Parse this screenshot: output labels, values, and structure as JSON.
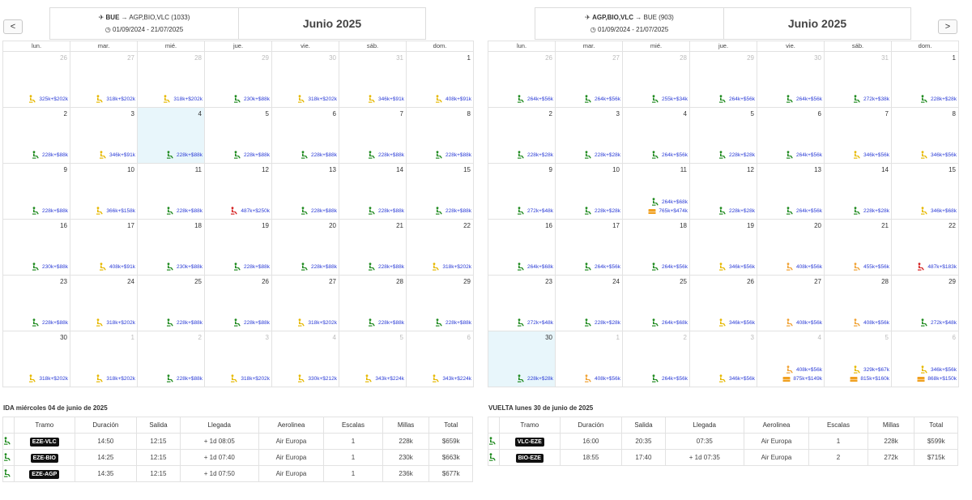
{
  "nav": {
    "prev": "<",
    "next": ">"
  },
  "left": {
    "route": "BUE → AGP,BIO,VLC (1033)",
    "origin": "BUE",
    "dest": "AGP,BIO,VLC (1033)",
    "dates": "01/09/2024 - 21/07/2025",
    "month": "Junio 2025",
    "dows": [
      "lun.",
      "mar.",
      "mié.",
      "jue.",
      "vie.",
      "sáb.",
      "dom."
    ],
    "weeks": [
      [
        {
          "d": "26",
          "dim": true,
          "p": "325k+$202k",
          "c": "y"
        },
        {
          "d": "27",
          "dim": true,
          "p": "318k+$202k",
          "c": "y"
        },
        {
          "d": "28",
          "dim": true,
          "p": "318k+$202k",
          "c": "y"
        },
        {
          "d": "29",
          "dim": true,
          "p": "230k+$88k",
          "c": "g"
        },
        {
          "d": "30",
          "dim": true,
          "p": "318k+$202k",
          "c": "y"
        },
        {
          "d": "31",
          "dim": true,
          "p": "346k+$91k",
          "c": "y"
        },
        {
          "d": "1",
          "p": "408k+$91k",
          "c": "y"
        }
      ],
      [
        {
          "d": "2",
          "p": "228k+$88k",
          "c": "g"
        },
        {
          "d": "3",
          "p": "346k+$91k",
          "c": "y"
        },
        {
          "d": "4",
          "sel": true,
          "p": "228k+$88k",
          "c": "g"
        },
        {
          "d": "5",
          "p": "228k+$88k",
          "c": "g"
        },
        {
          "d": "6",
          "p": "228k+$88k",
          "c": "g"
        },
        {
          "d": "7",
          "p": "228k+$88k",
          "c": "g"
        },
        {
          "d": "8",
          "p": "228k+$88k",
          "c": "g"
        }
      ],
      [
        {
          "d": "9",
          "p": "228k+$88k",
          "c": "g"
        },
        {
          "d": "10",
          "p": "366k+$158k",
          "c": "y"
        },
        {
          "d": "11",
          "p": "228k+$88k",
          "c": "g"
        },
        {
          "d": "12",
          "p": "487k+$250k",
          "c": "r"
        },
        {
          "d": "13",
          "p": "228k+$88k",
          "c": "g"
        },
        {
          "d": "14",
          "p": "228k+$88k",
          "c": "g"
        },
        {
          "d": "15",
          "p": "228k+$88k",
          "c": "g"
        }
      ],
      [
        {
          "d": "16",
          "p": "230k+$88k",
          "c": "g"
        },
        {
          "d": "17",
          "p": "408k+$91k",
          "c": "y"
        },
        {
          "d": "18",
          "p": "230k+$88k",
          "c": "g"
        },
        {
          "d": "19",
          "p": "228k+$88k",
          "c": "g"
        },
        {
          "d": "20",
          "p": "228k+$88k",
          "c": "g"
        },
        {
          "d": "21",
          "p": "228k+$88k",
          "c": "g"
        },
        {
          "d": "22",
          "p": "318k+$202k",
          "c": "y"
        }
      ],
      [
        {
          "d": "23",
          "p": "228k+$88k",
          "c": "g"
        },
        {
          "d": "24",
          "p": "318k+$202k",
          "c": "y"
        },
        {
          "d": "25",
          "p": "228k+$88k",
          "c": "g"
        },
        {
          "d": "26",
          "p": "228k+$88k",
          "c": "g"
        },
        {
          "d": "27",
          "p": "318k+$202k",
          "c": "y"
        },
        {
          "d": "28",
          "p": "228k+$88k",
          "c": "g"
        },
        {
          "d": "29",
          "p": "228k+$88k",
          "c": "g"
        }
      ],
      [
        {
          "d": "30",
          "p": "318k+$202k",
          "c": "y"
        },
        {
          "d": "1",
          "dim": true,
          "p": "318k+$202k",
          "c": "y"
        },
        {
          "d": "2",
          "dim": true,
          "p": "228k+$88k",
          "c": "g"
        },
        {
          "d": "3",
          "dim": true,
          "p": "318k+$202k",
          "c": "y"
        },
        {
          "d": "4",
          "dim": true,
          "p": "330k+$212k",
          "c": "y"
        },
        {
          "d": "5",
          "dim": true,
          "p": "343k+$224k",
          "c": "y"
        },
        {
          "d": "6",
          "dim": true,
          "p": "343k+$224k",
          "c": "y"
        }
      ]
    ],
    "section": "IDA miércoles 04 de junio de 2025",
    "headers": [
      "Tramo",
      "Duración",
      "Salida",
      "Llegada",
      "Aerolinea",
      "Escalas",
      "Millas",
      "Total"
    ],
    "rows": [
      {
        "tramo": "EZE-VLC",
        "dur": "14:50",
        "sal": "12:15",
        "lle": "+ 1d 08:05",
        "aer": "Air Europa",
        "esc": "1",
        "mil": "228k",
        "tot": "$659k"
      },
      {
        "tramo": "EZE-BIO",
        "dur": "14:25",
        "sal": "12:15",
        "lle": "+ 1d 07:40",
        "aer": "Air Europa",
        "esc": "1",
        "mil": "230k",
        "tot": "$663k"
      },
      {
        "tramo": "EZE-AGP",
        "dur": "14:35",
        "sal": "12:15",
        "lle": "+ 1d 07:50",
        "aer": "Air Europa",
        "esc": "1",
        "mil": "236k",
        "tot": "$677k"
      }
    ]
  },
  "right": {
    "route": "AGP,BIO,VLC → BUE (903)",
    "origin": "AGP,BIO,VLC",
    "dest": "BUE (903)",
    "dates": "01/09/2024 - 21/07/2025",
    "month": "Junio 2025",
    "dows": [
      "lun.",
      "mar.",
      "mié.",
      "jue.",
      "vie.",
      "sáb.",
      "dom."
    ],
    "weeks": [
      [
        {
          "d": "26",
          "dim": true,
          "p": "264k+$56k",
          "c": "g"
        },
        {
          "d": "27",
          "dim": true,
          "p": "264k+$56k",
          "c": "g"
        },
        {
          "d": "28",
          "dim": true,
          "p": "255k+$34k",
          "c": "g"
        },
        {
          "d": "29",
          "dim": true,
          "p": "264k+$56k",
          "c": "g"
        },
        {
          "d": "30",
          "dim": true,
          "p": "264k+$56k",
          "c": "g"
        },
        {
          "d": "31",
          "dim": true,
          "p": "272k+$38k",
          "c": "g"
        },
        {
          "d": "1",
          "p": "228k+$28k",
          "c": "g"
        }
      ],
      [
        {
          "d": "2",
          "p": "228k+$28k",
          "c": "g"
        },
        {
          "d": "3",
          "p": "228k+$28k",
          "c": "g"
        },
        {
          "d": "4",
          "p": "264k+$56k",
          "c": "g"
        },
        {
          "d": "5",
          "p": "228k+$28k",
          "c": "g"
        },
        {
          "d": "6",
          "p": "264k+$56k",
          "c": "g"
        },
        {
          "d": "7",
          "p": "346k+$56k",
          "c": "y"
        },
        {
          "d": "8",
          "p": "346k+$56k",
          "c": "y"
        }
      ],
      [
        {
          "d": "9",
          "p": "272k+$48k",
          "c": "g"
        },
        {
          "d": "10",
          "p": "228k+$28k",
          "c": "g"
        },
        {
          "d": "11",
          "p2": "264k+$68k",
          "c2": "g",
          "p": "765k+$474k",
          "c": "b"
        },
        {
          "d": "12",
          "p": "228k+$28k",
          "c": "g"
        },
        {
          "d": "13",
          "p": "264k+$56k",
          "c": "g"
        },
        {
          "d": "14",
          "p": "228k+$28k",
          "c": "g"
        },
        {
          "d": "15",
          "p": "346k+$68k",
          "c": "y"
        }
      ],
      [
        {
          "d": "16",
          "p": "264k+$68k",
          "c": "g"
        },
        {
          "d": "17",
          "p": "264k+$56k",
          "c": "g"
        },
        {
          "d": "18",
          "p": "264k+$56k",
          "c": "g"
        },
        {
          "d": "19",
          "p": "346k+$56k",
          "c": "y"
        },
        {
          "d": "20",
          "p": "408k+$56k",
          "c": "o"
        },
        {
          "d": "21",
          "p": "455k+$56k",
          "c": "o"
        },
        {
          "d": "22",
          "p": "487k+$183k",
          "c": "r"
        }
      ],
      [
        {
          "d": "23",
          "p": "272k+$48k",
          "c": "g"
        },
        {
          "d": "24",
          "p": "228k+$28k",
          "c": "g"
        },
        {
          "d": "25",
          "p": "264k+$68k",
          "c": "g"
        },
        {
          "d": "26",
          "p": "346k+$56k",
          "c": "y"
        },
        {
          "d": "27",
          "p": "408k+$56k",
          "c": "o"
        },
        {
          "d": "28",
          "p": "408k+$56k",
          "c": "o"
        },
        {
          "d": "29",
          "p": "272k+$48k",
          "c": "g"
        }
      ],
      [
        {
          "d": "30",
          "sel": true,
          "p": "228k+$28k",
          "c": "g"
        },
        {
          "d": "1",
          "dim": true,
          "p": "408k+$56k",
          "c": "o"
        },
        {
          "d": "2",
          "dim": true,
          "p": "264k+$56k",
          "c": "g"
        },
        {
          "d": "3",
          "dim": true,
          "p": "346k+$56k",
          "c": "y"
        },
        {
          "d": "4",
          "dim": true,
          "p2": "408k+$56k",
          "c2": "o",
          "p": "875k+$149k",
          "c": "b"
        },
        {
          "d": "5",
          "dim": true,
          "p2": "329k+$67k",
          "c2": "y",
          "p": "815k+$160k",
          "c": "b"
        },
        {
          "d": "6",
          "dim": true,
          "p2": "346k+$56k",
          "c2": "y",
          "p": "868k+$150k",
          "c": "b"
        }
      ]
    ],
    "section": "VUELTA lunes 30 de junio de 2025",
    "headers": [
      "Tramo",
      "Duración",
      "Salida",
      "Llegada",
      "Aerolinea",
      "Escalas",
      "Millas",
      "Total"
    ],
    "rows": [
      {
        "tramo": "VLC-EZE",
        "dur": "16:00",
        "sal": "20:35",
        "lle": "07:35",
        "aer": "Air Europa",
        "esc": "1",
        "mil": "228k",
        "tot": "$599k"
      },
      {
        "tramo": "BIO-EZE",
        "dur": "18:55",
        "sal": "17:40",
        "lle": "+ 1d 07:35",
        "aer": "Air Europa",
        "esc": "2",
        "mil": "272k",
        "tot": "$715k"
      }
    ]
  },
  "colors": {
    "g": "#1e8a1e",
    "y": "#e6b800",
    "o": "#f0a030",
    "r": "#d42020",
    "b": "#f0a020",
    "price": "#2a3bd6"
  }
}
